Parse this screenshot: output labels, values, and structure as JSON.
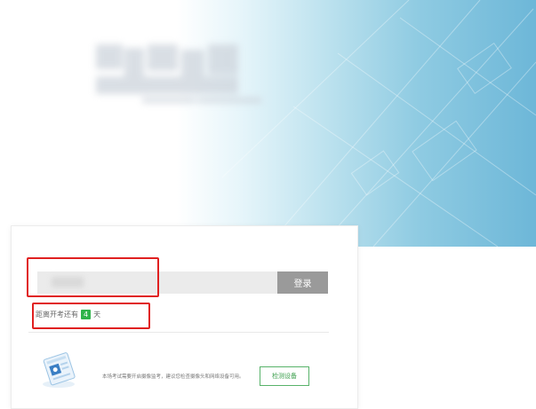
{
  "login": {
    "input_placeholder": "",
    "button_label": "登录"
  },
  "countdown": {
    "prefix": "距离开考还有",
    "days": "4",
    "suffix": "天"
  },
  "device_check": {
    "notice": "本场考试需要开启摄像监考，建议您检查摄像头和网络设备可用。",
    "button_label": "检测设备"
  },
  "colors": {
    "hero_accent": "#6db7d8",
    "badge_green": "#2fb34a",
    "button_gray": "#9a9a9a",
    "highlight_red": "#e02020"
  },
  "icons": {
    "device": "exam-device-icon"
  }
}
